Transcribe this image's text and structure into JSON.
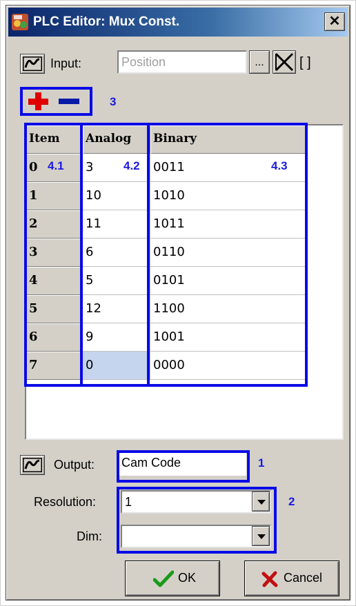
{
  "window": {
    "title": "PLC Editor: Mux Const.",
    "close_label": "✕"
  },
  "input": {
    "label": "Input:",
    "value": "Position",
    "browse_label": "...",
    "bracket": "[ ]"
  },
  "annotations": {
    "a1": "1",
    "a2": "2",
    "a3": "3",
    "a41": "4.1",
    "a42": "4.2",
    "a43": "4.3"
  },
  "table": {
    "headers": [
      "Item",
      "Analog",
      "Binary"
    ],
    "rows": [
      {
        "item": "0",
        "analog": "3",
        "binary": "0011"
      },
      {
        "item": "1",
        "analog": "10",
        "binary": "1010"
      },
      {
        "item": "2",
        "analog": "11",
        "binary": "1011"
      },
      {
        "item": "3",
        "analog": "6",
        "binary": "0110"
      },
      {
        "item": "4",
        "analog": "5",
        "binary": "0101"
      },
      {
        "item": "5",
        "analog": "12",
        "binary": "1100"
      },
      {
        "item": "6",
        "analog": "9",
        "binary": "1001"
      },
      {
        "item": "7",
        "analog": "0",
        "binary": "0000"
      }
    ]
  },
  "output": {
    "label": "Output:",
    "value": "Cam Code"
  },
  "resolution": {
    "label": "Resolution:",
    "value": "1"
  },
  "dim": {
    "label": "Dim:",
    "value": ""
  },
  "buttons": {
    "ok": "OK",
    "cancel": "Cancel"
  },
  "colors": {
    "annotation_blue": "#0a0ae6",
    "title_bar": "#0a246a",
    "add_red": "#e00000"
  },
  "icons": [
    "app-icon",
    "waveform-icon",
    "delete-x-icon",
    "plus-icon",
    "minus-icon",
    "check-icon",
    "cancel-x-icon",
    "close-icon"
  ]
}
